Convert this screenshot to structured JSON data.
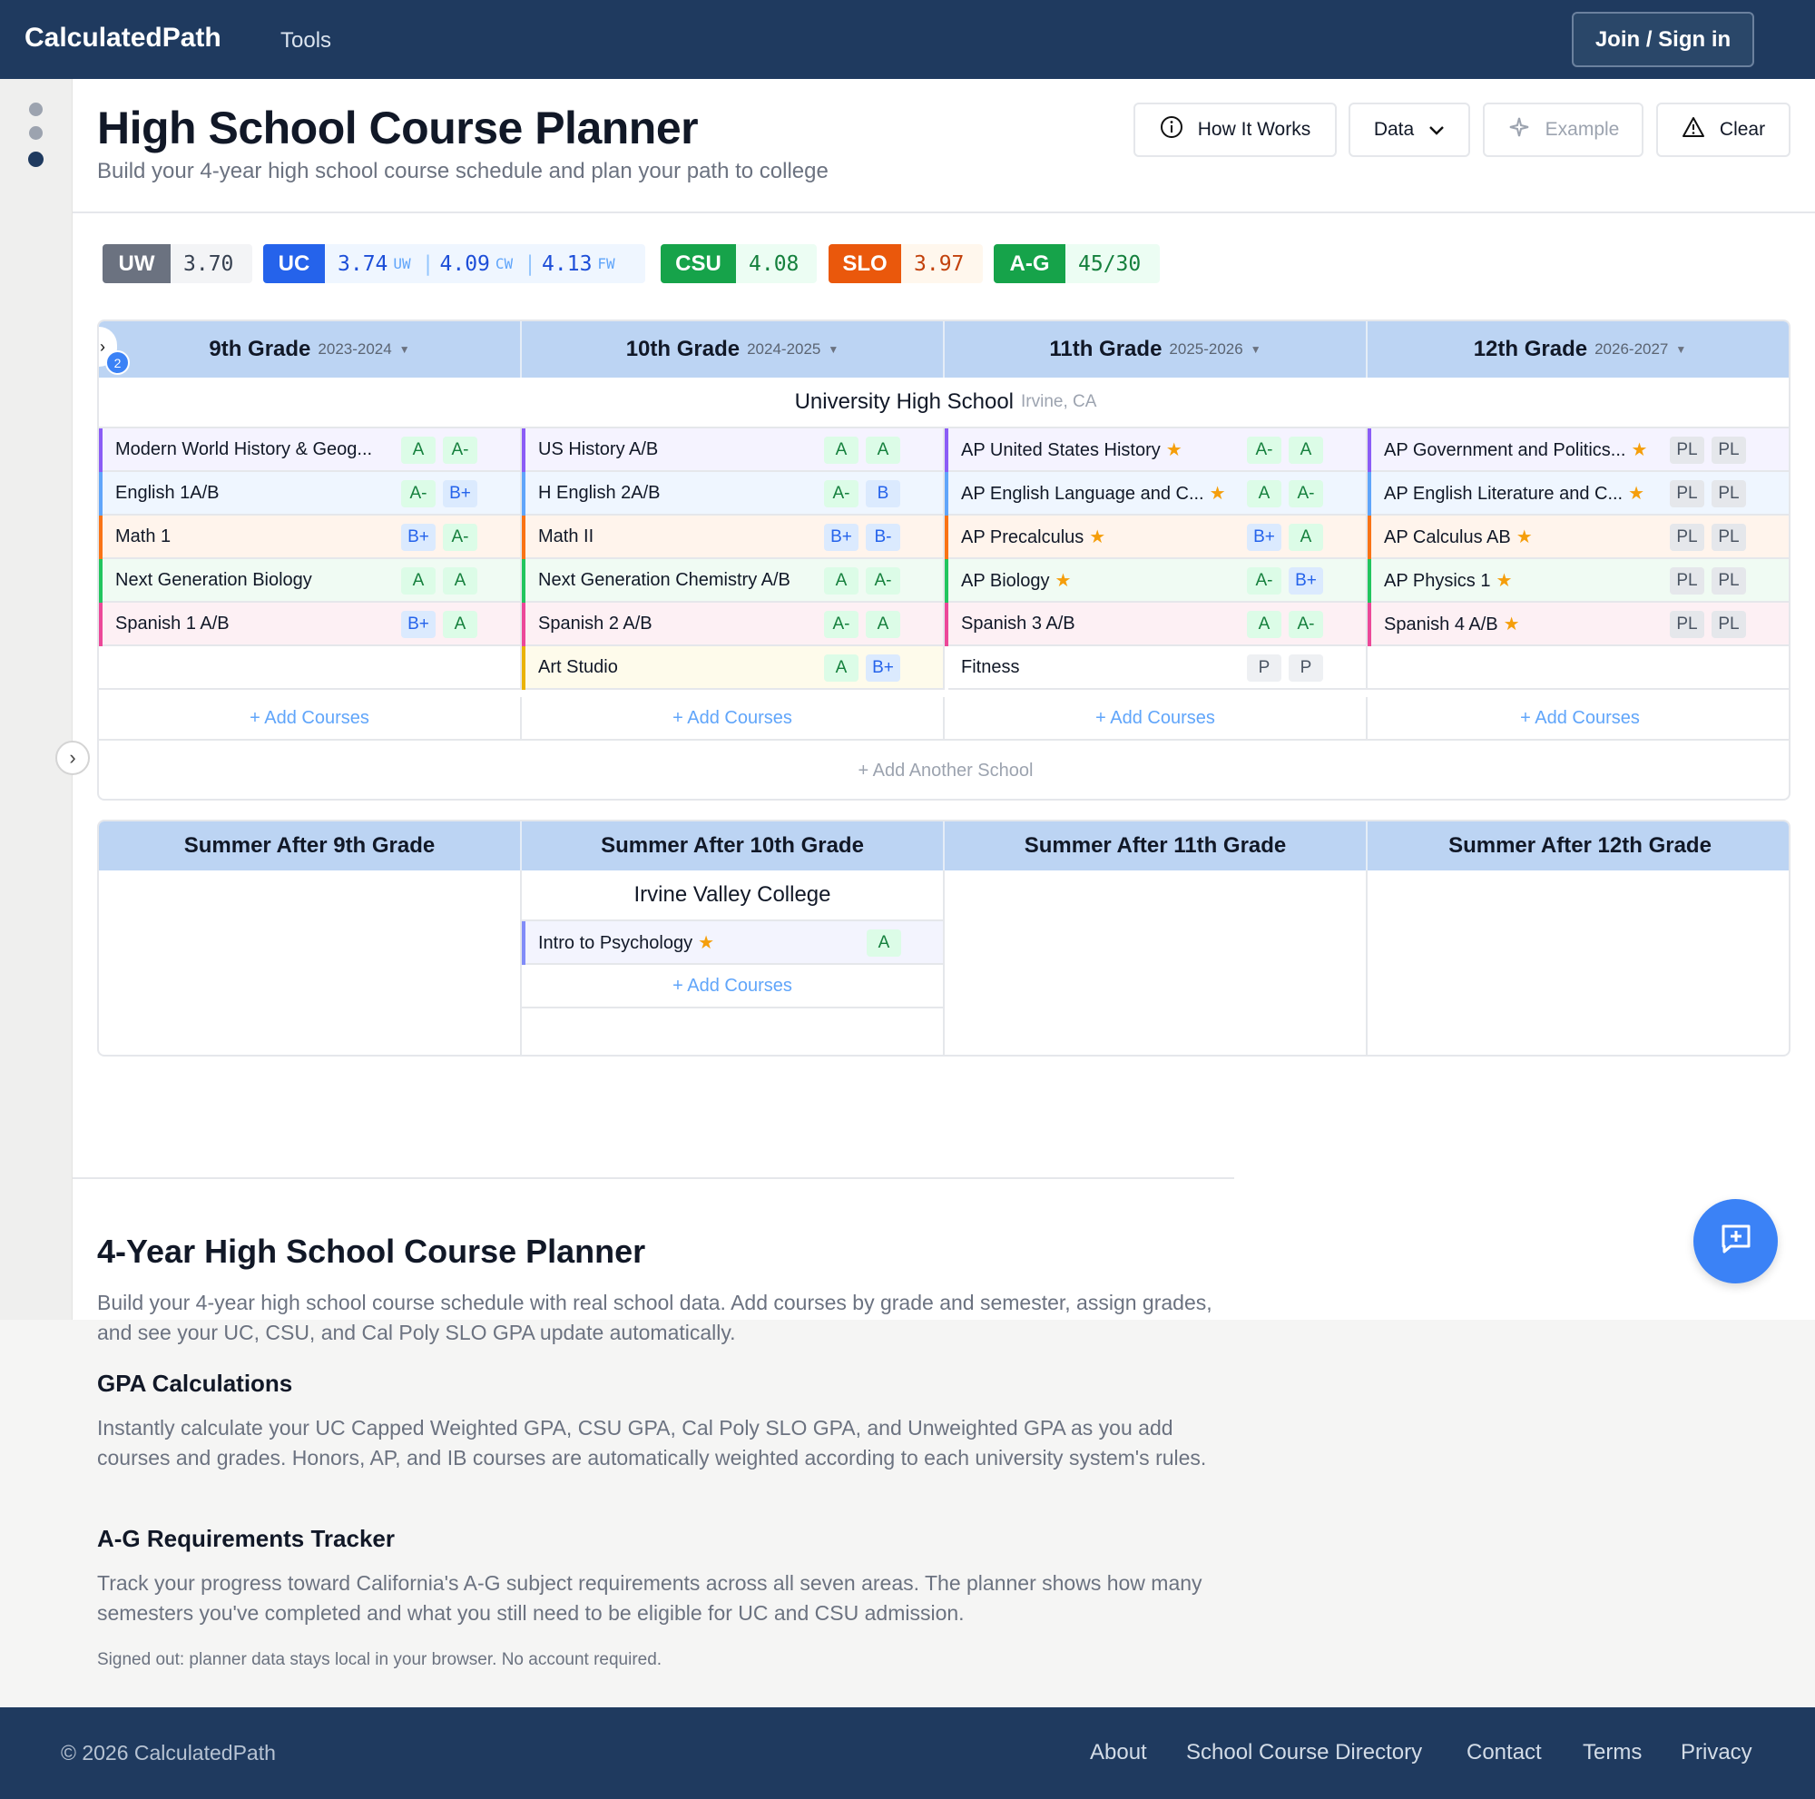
{
  "app": {
    "brand": "CalculatedPath",
    "nav_tools": "Tools",
    "signin": "Join / Sign in"
  },
  "header": {
    "title": "High School Course Planner",
    "subtitle": "Build your 4-year high school course schedule and plan your path to college",
    "buttons": {
      "how": "How It Works",
      "data": "Data",
      "example": "Example",
      "clear": "Clear"
    }
  },
  "gpa": {
    "uw": {
      "label": "UW",
      "value": "3.70"
    },
    "uc": {
      "label": "UC",
      "v1": "3.74",
      "s1": "UW",
      "v2": "4.09",
      "s2": "CW",
      "v3": "4.13",
      "s3": "FW"
    },
    "csu": {
      "label": "CSU",
      "value": "4.08"
    },
    "slo": {
      "label": "SLO",
      "value": "3.97"
    },
    "ag": {
      "label": "A-G",
      "value": "45/30"
    }
  },
  "planner": {
    "badge_count": "2",
    "grades": [
      {
        "name": "9th Grade",
        "years": "2023-2024"
      },
      {
        "name": "10th Grade",
        "years": "2024-2025"
      },
      {
        "name": "11th Grade",
        "years": "2025-2026"
      },
      {
        "name": "12th Grade",
        "years": "2026-2027"
      }
    ],
    "school": {
      "name": "University High School",
      "location": "Irvine, CA"
    },
    "courses": [
      [
        {
          "name": "Modern World History & Geog...",
          "star": false,
          "g1": "A",
          "g2": "A-",
          "color": "#8b5cf6",
          "bg": "#f5f3ff"
        },
        {
          "name": "English 1A/B",
          "star": false,
          "g1": "A-",
          "g2": "B+",
          "color": "#60a5fa",
          "bg": "#eff6ff"
        },
        {
          "name": "Math 1",
          "star": false,
          "g1": "B+",
          "g2": "A-",
          "color": "#f97316",
          "bg": "#fff4ec"
        },
        {
          "name": "Next Generation Biology",
          "star": false,
          "g1": "A",
          "g2": "A",
          "color": "#22c55e",
          "bg": "#f0fbf3"
        },
        {
          "name": "Spanish 1 A/B",
          "star": false,
          "g1": "B+",
          "g2": "A",
          "color": "#ec4899",
          "bg": "#fdf0f4"
        }
      ],
      [
        {
          "name": "US History A/B",
          "star": false,
          "g1": "A",
          "g2": "A",
          "color": "#8b5cf6",
          "bg": "#f5f3ff"
        },
        {
          "name": "H English 2A/B",
          "star": false,
          "g1": "A-",
          "g2": "B",
          "color": "#60a5fa",
          "bg": "#eff6ff"
        },
        {
          "name": "Math II",
          "star": false,
          "g1": "B+",
          "g2": "B-",
          "color": "#f97316",
          "bg": "#fff4ec"
        },
        {
          "name": "Next Generation Chemistry A/B",
          "star": false,
          "g1": "A",
          "g2": "A-",
          "color": "#22c55e",
          "bg": "#f0fbf3"
        },
        {
          "name": "Spanish 2 A/B",
          "star": false,
          "g1": "A-",
          "g2": "A",
          "color": "#ec4899",
          "bg": "#fdf0f4"
        },
        {
          "name": "Art Studio",
          "star": false,
          "g1": "A",
          "g2": "B+",
          "color": "#eab308",
          "bg": "#fefbeb"
        }
      ],
      [
        {
          "name": "AP United States History",
          "star": true,
          "g1": "A-",
          "g2": "A",
          "color": "#8b5cf6",
          "bg": "#f5f3ff"
        },
        {
          "name": "AP English Language and C...",
          "star": true,
          "g1": "A",
          "g2": "A-",
          "color": "#60a5fa",
          "bg": "#eff6ff"
        },
        {
          "name": "AP Precalculus",
          "star": true,
          "g1": "B+",
          "g2": "A",
          "color": "#f97316",
          "bg": "#fff4ec"
        },
        {
          "name": "AP Biology",
          "star": true,
          "g1": "A-",
          "g2": "B+",
          "color": "#22c55e",
          "bg": "#f0fbf3"
        },
        {
          "name": "Spanish 3 A/B",
          "star": false,
          "g1": "A",
          "g2": "A-",
          "color": "#ec4899",
          "bg": "#fdf0f4"
        },
        {
          "name": "Fitness",
          "star": false,
          "g1": "P",
          "g2": "P",
          "color": "#ffffff",
          "bg": "#ffffff"
        }
      ],
      [
        {
          "name": "AP Government and Politics...",
          "star": true,
          "g1": "PL",
          "g2": "PL",
          "color": "#8b5cf6",
          "bg": "#f5f3ff"
        },
        {
          "name": "AP English Literature and C...",
          "star": true,
          "g1": "PL",
          "g2": "PL",
          "color": "#60a5fa",
          "bg": "#eff6ff"
        },
        {
          "name": "AP Calculus AB",
          "star": true,
          "g1": "PL",
          "g2": "PL",
          "color": "#f97316",
          "bg": "#fff4ec"
        },
        {
          "name": "AP Physics 1",
          "star": true,
          "g1": "PL",
          "g2": "PL",
          "color": "#22c55e",
          "bg": "#f0fbf3"
        },
        {
          "name": "Spanish 4 A/B",
          "star": true,
          "g1": "PL",
          "g2": "PL",
          "color": "#ec4899",
          "bg": "#fdf0f4"
        }
      ]
    ],
    "add_courses": "+ Add Courses",
    "add_school": "+  Add Another School"
  },
  "summer": {
    "headers": [
      "Summer After 9th Grade",
      "Summer After 10th Grade",
      "Summer After 11th Grade",
      "Summer After 12th Grade"
    ],
    "school": "Irvine Valley College",
    "course": {
      "name": "Intro to Psychology",
      "star": true,
      "g1": "A",
      "color": "#818cf8",
      "bg": "#f3f4fe"
    },
    "add_courses": "+ Add Courses"
  },
  "article": {
    "title": "4-Year High School Course Planner",
    "p1": "Build your 4-year high school course schedule with real school data. Add courses by grade and semester, assign grades, and see your UC, CSU, and Cal Poly SLO GPA update automatically.",
    "h_gpa": "GPA Calculations",
    "p2": "Instantly calculate your UC Capped Weighted GPA, CSU GPA, Cal Poly SLO GPA, and Unweighted GPA as you add courses and grades. Honors, AP, and IB courses are automatically weighted according to each university system's rules.",
    "h_ag": "A-G Requirements Tracker",
    "p3": "Track your progress toward California's A-G subject requirements across all seven areas. The planner shows how many semesters you've completed and what you still need to be eligible for UC and CSU admission.",
    "note": "Signed out: planner data stays local in your browser. No account required."
  },
  "footer": {
    "copy": "© 2026 CalculatedPath",
    "links": [
      "About",
      "School Course Directory",
      "Contact",
      "Terms",
      "Privacy"
    ]
  }
}
